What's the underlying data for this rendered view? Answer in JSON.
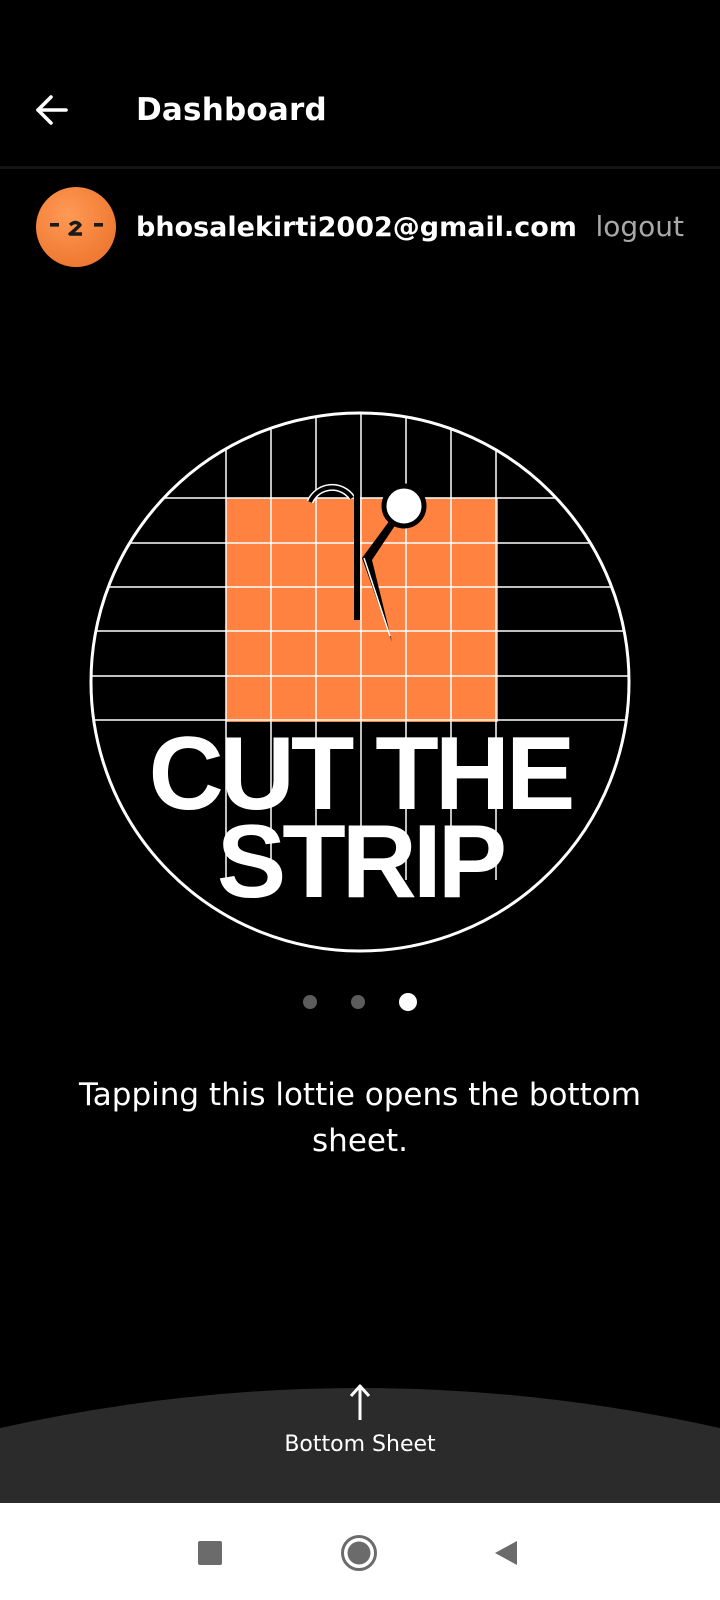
{
  "header": {
    "title": "Dashboard",
    "back_icon": "arrow-left-icon"
  },
  "user": {
    "email": "bhosalekirti2002@gmail.com",
    "logout_label": "logout",
    "avatar_color": "#f47b36"
  },
  "carousel": {
    "artwork_text_line1": "CUT THE",
    "artwork_text_line2": "STRIP",
    "accent_color": "#ff8240",
    "page_count": 3,
    "active_page": 3,
    "caption": "Tapping this lottie opens the bottom sheet."
  },
  "bottom_sheet": {
    "label": "Bottom Sheet",
    "icon": "arrow-up-icon",
    "color": "#2b2b2b"
  },
  "system_nav": {
    "recents_icon": "square-icon",
    "home_icon": "circle-home-icon",
    "back_icon": "triangle-back-icon"
  }
}
